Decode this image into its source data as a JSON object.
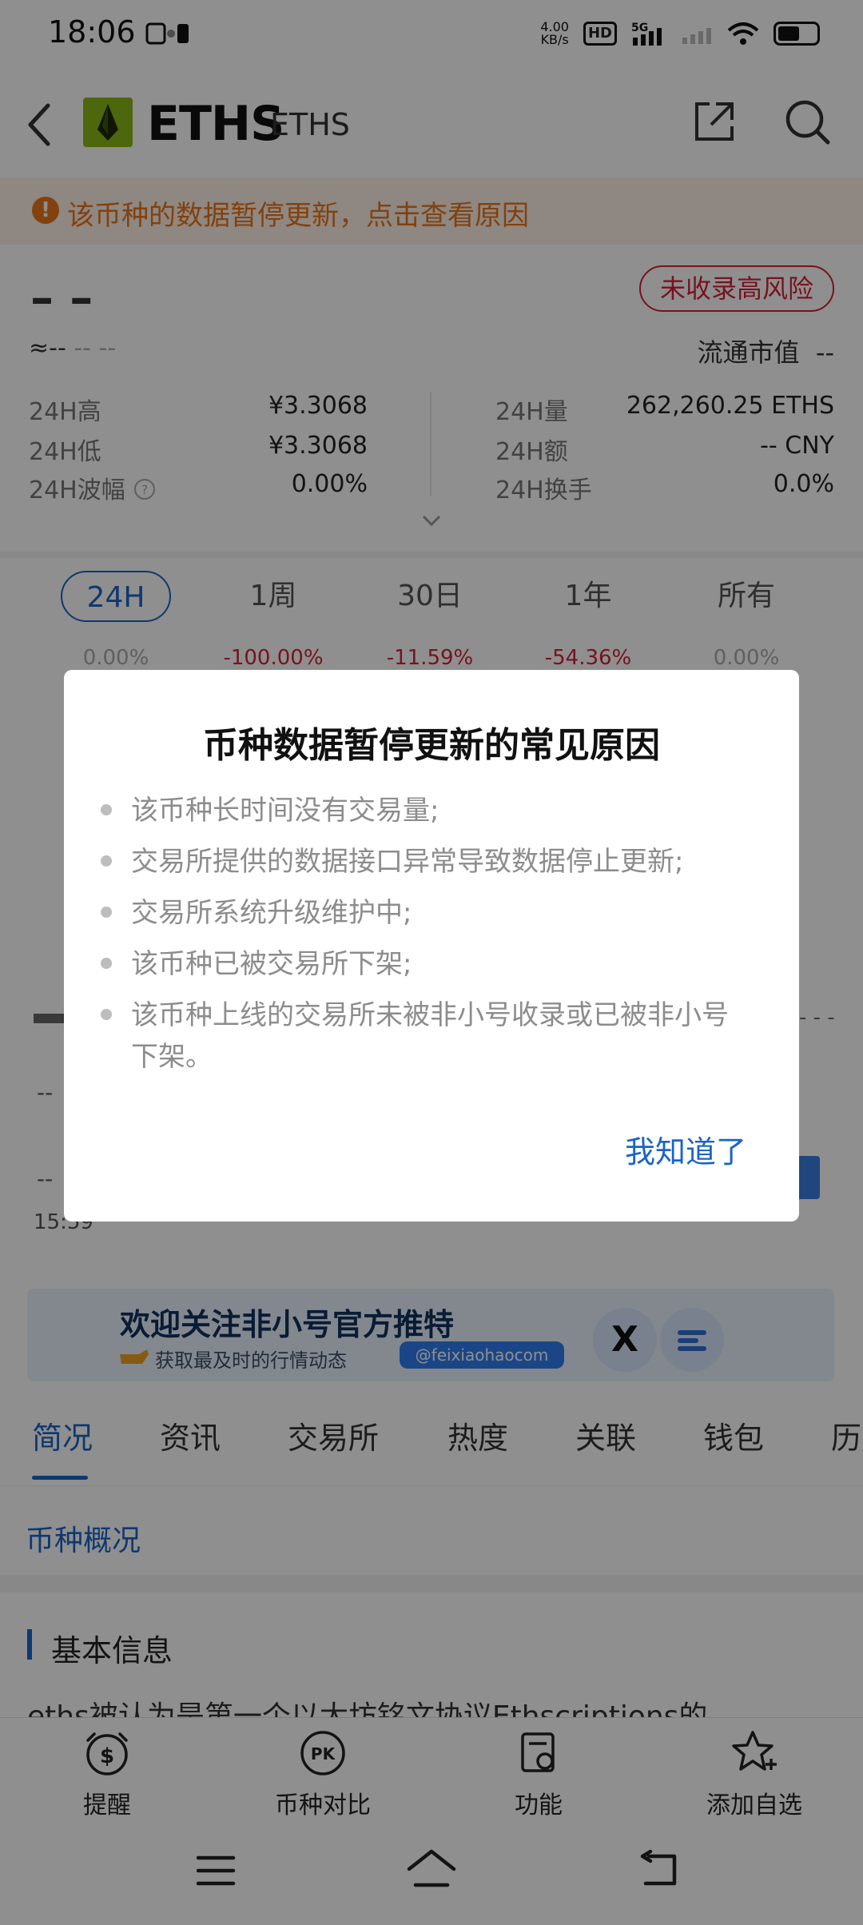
{
  "status_bar": {
    "time": "18:06",
    "net_speed_value": "4.00",
    "net_speed_unit": "KB/s",
    "hd_label": "HD",
    "signal_label": "5G"
  },
  "header": {
    "coin_name": "ETHS",
    "coin_symbol": "ETHS"
  },
  "notice": {
    "text": "该币种的数据暂停更新，点击查看原因",
    "icon": "!"
  },
  "price": {
    "main": "– –",
    "risk_badge": "未收录高风险",
    "approx_prefix": "≈--",
    "approx_rest": "-- --",
    "market_cap_label": "流通市值",
    "market_cap_value": "--"
  },
  "stats": {
    "high_label": "24H高",
    "high_value": "¥3.3068",
    "low_label": "24H低",
    "low_value": "¥3.3068",
    "volatility_label": "24H波幅",
    "volatility_value": "0.00%",
    "volume_label": "24H量",
    "volume_value": "262,260.25 ETHS",
    "amount_label": "24H额",
    "amount_value": "-- CNY",
    "turnover_label": "24H换手",
    "turnover_value": "0.0%"
  },
  "periods": [
    {
      "label": "24H",
      "pct": "0.00%"
    },
    {
      "label": "1周",
      "pct": "-100.00%"
    },
    {
      "label": "30日",
      "pct": "-11.59%"
    },
    {
      "label": "1年",
      "pct": "-54.36%"
    },
    {
      "label": "所有",
      "pct": "0.00%"
    }
  ],
  "chart_area": {
    "left_dash_1": "--",
    "left_dash_2": "--",
    "time_label": "15:59"
  },
  "ad": {
    "title": "欢迎关注非小号官方推特",
    "subtitle": "获取最及时的行情动态",
    "handle": "@feixiaohaocom",
    "x_logo": "X"
  },
  "section_tabs": [
    "简况",
    "资讯",
    "交易所",
    "热度",
    "关联",
    "钱包",
    "历"
  ],
  "overview": {
    "title": "币种概况",
    "basic_info_title": "基本信息",
    "description": "eths被认为是第一个以太坊铭文协议Ethscriptions的"
  },
  "bottom_bar": [
    {
      "label": "提醒",
      "icon": "alarm-dollar-icon"
    },
    {
      "label": "币种对比",
      "icon": "pk-icon"
    },
    {
      "label": "功能",
      "icon": "function-icon"
    },
    {
      "label": "添加自选",
      "icon": "star-add-icon"
    }
  ],
  "dialog": {
    "title": "币种数据暂停更新的常见原因",
    "reasons": [
      "该币种长时间没有交易量;",
      "交易所提供的数据接口异常导致数据停止更新;",
      "交易所系统升级维护中;",
      "该币种已被交易所下架;",
      "该币种上线的交易所未被非小号收录或已被非小号下架。"
    ],
    "ok_label": "我知道了"
  },
  "colors": {
    "accent": "#1a64c8",
    "risk": "#d6203a",
    "notice": "#e8741a",
    "negative": "#d6203a"
  }
}
